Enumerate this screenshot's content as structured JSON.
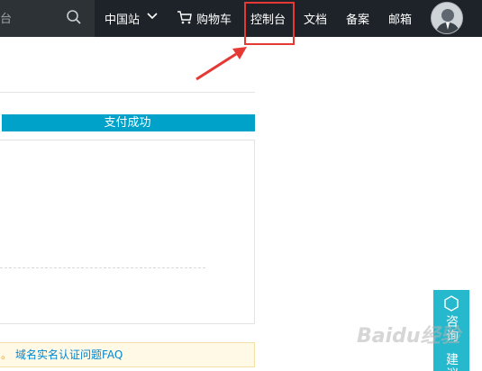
{
  "search": {
    "text": "台"
  },
  "nav": {
    "region": "中国站",
    "cart": "购物车",
    "console": "控制台",
    "docs": "文档",
    "filing": "备案",
    "mail": "邮箱"
  },
  "main": {
    "step_label": "支付成功",
    "notice_prefix": "。",
    "notice_link": "域名实名认证问题FAQ"
  },
  "side": {
    "consult": "咨询",
    "suggest": "建议"
  },
  "watermark": {
    "text": "Baidu经验"
  },
  "colors": {
    "topbar": "#1e2329",
    "accent": "#00a2ca",
    "highlight": "#e53935",
    "side_panel": "#26b8cc",
    "link": "#0088d1"
  }
}
